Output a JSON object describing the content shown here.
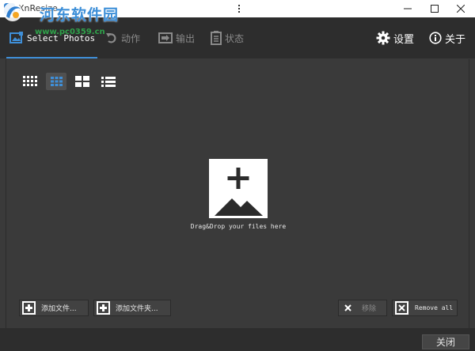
{
  "window": {
    "title": "XnResize",
    "controls": {
      "menu": "menu-icon",
      "minimize": "minimize-icon",
      "maximize": "maximize-icon",
      "close": "close-icon"
    }
  },
  "watermark": {
    "site_name": "河东软件园",
    "url": "www.pc0359.cn"
  },
  "nav": {
    "tabs": [
      {
        "label": "Select Photos",
        "icon": "photos-icon",
        "active": true
      },
      {
        "label": "动作",
        "icon": "undo-arrow-icon",
        "active": false
      },
      {
        "label": "输出",
        "icon": "export-icon",
        "active": false
      },
      {
        "label": "状态",
        "icon": "list-document-icon",
        "active": false
      }
    ],
    "right": [
      {
        "label": "设置",
        "icon": "gear-icon"
      },
      {
        "label": "关于",
        "icon": "info-icon"
      }
    ]
  },
  "view_modes": [
    {
      "name": "small-grid",
      "icon": "grid-small-icon",
      "active": false
    },
    {
      "name": "medium-grid",
      "icon": "grid-medium-icon",
      "active": true
    },
    {
      "name": "large-grid",
      "icon": "grid-large-icon",
      "active": false
    },
    {
      "name": "list",
      "icon": "list-icon",
      "active": false
    }
  ],
  "dropzone": {
    "icon": "add-image-icon",
    "text": "Drag&Drop your files here"
  },
  "actions": {
    "add_files": "添加文件...",
    "add_folder": "添加文件夹...",
    "remove": "移除",
    "remove_all": "Remove all"
  },
  "footer": {
    "close": "关闭"
  },
  "colors": {
    "accent": "#3f8fd8",
    "background": "#3a3a3a",
    "navbar": "#2d2d2d"
  }
}
